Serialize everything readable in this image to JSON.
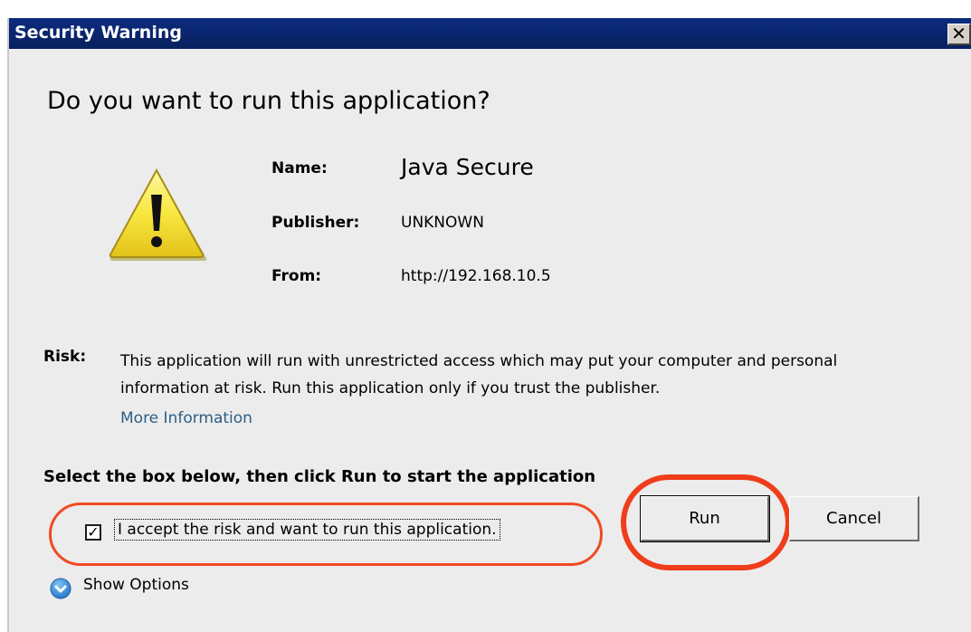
{
  "window": {
    "title": "Security Warning",
    "close_glyph": "✕",
    "close_icon": "close-icon"
  },
  "dialog": {
    "question": "Do you want to run this application?",
    "icon": "warning-icon",
    "name_label": "Name:",
    "name_value": "Java Secure",
    "publisher_label": "Publisher:",
    "publisher_value": "UNKNOWN",
    "from_label": "From:",
    "from_value": "http://192.168.10.5",
    "risk_label": "Risk:",
    "risk_text": "This application will run with unrestricted access which may put your computer and personal information at risk. Run this application only if you trust the publisher.",
    "more_info_link": "More Information",
    "instruction": "Select the box below, then click Run to start the application",
    "accept_checkbox_checked": true,
    "checkmark": "✓",
    "accept_label": "I accept the risk and want to run this application.",
    "run_label": "Run",
    "cancel_label": "Cancel",
    "show_options_label": "Show Options",
    "options_icon": "chevron-down-icon"
  },
  "colors": {
    "titlebar": "#0a246a",
    "highlight_red": "#f04a22",
    "link": "#2d5f85",
    "dialog_bg": "#ececec",
    "warning_yellow": "#f6e33c"
  }
}
